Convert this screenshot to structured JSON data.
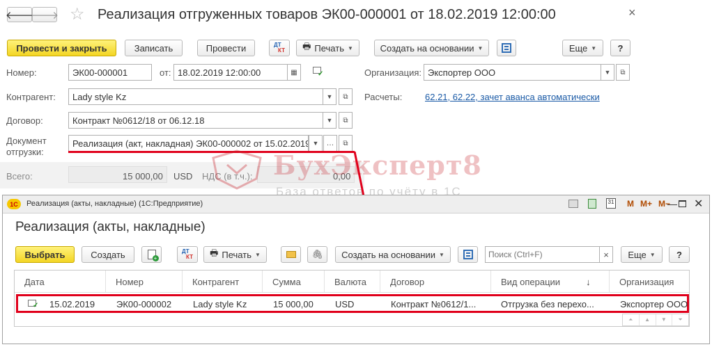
{
  "doc": {
    "title": "Реализация отгруженных товаров ЭК00-000001 от 18.02.2019 12:00:00",
    "toolbar": {
      "post_close": "Провести и закрыть",
      "save": "Записать",
      "post": "Провести",
      "dtkt_top": "ДТ",
      "dtkt_bottom": "КТ",
      "print": "Печать",
      "create_based": "Создать на основании",
      "more": "Еще",
      "help": "?"
    },
    "fields": {
      "number_label": "Номер:",
      "number_value": "ЭК00-000001",
      "date_label": "от:",
      "date_value": "18.02.2019 12:00:00",
      "org_label": "Организация:",
      "org_value": "Экспортер ООО",
      "counterparty_label": "Контрагент:",
      "counterparty_value": "Lady style Kz",
      "settlements_label": "Расчеты:",
      "settlements_link": "62.21, 62.22, зачет аванса автоматически",
      "contract_label": "Договор:",
      "contract_value": "Контракт №0612/18 от 06.12.18",
      "shipment_label_1": "Документ",
      "shipment_label_2": "отгрузки:",
      "shipment_value": "Реализация (акт, накладная) ЭК00-000002 от 15.02.2019",
      "total_label": "Всего:",
      "total_value": "15 000,00",
      "currency": "USD",
      "vat_label": "НДС (в т.ч.):",
      "vat_value": "0,00"
    }
  },
  "watermark": {
    "brand": "БухЭксперт8",
    "tagline": "База ответов по учёту в 1С"
  },
  "list": {
    "window_title": "Реализация (акты, накладные)  (1С:Предприятие)",
    "app_badge": "1С",
    "title_controls": {
      "m": "M",
      "mplus": "M+",
      "mminus": "M−"
    },
    "heading": "Реализация (акты, накладные)",
    "toolbar": {
      "select": "Выбрать",
      "create": "Создать",
      "dtkt_top": "ДТ",
      "dtkt_bottom": "КТ",
      "print": "Печать",
      "create_based": "Создать на основании",
      "search_placeholder": "Поиск (Ctrl+F)",
      "search_clear": "×",
      "more": "Еще",
      "help": "?"
    },
    "columns": [
      "Дата",
      "Номер",
      "Контрагент",
      "Сумма",
      "Валюта",
      "Договор",
      "Вид операции",
      "Организация"
    ],
    "sort_indicator": "↓",
    "rows": [
      {
        "date": "15.02.2019",
        "number": "ЭК00-000002",
        "counterparty": "Lady style Kz",
        "amount": "15 000,00",
        "currency": "USD",
        "contract": "Контракт №0612/1...",
        "operation": "Отгрузка без перехо...",
        "organization": "Экспортер ООО"
      }
    ]
  },
  "colors": {
    "accent_yellow": "#f3d524",
    "highlight_red": "#e0001b",
    "link_blue": "#1a5aa6",
    "watermark_red": "#c8232c"
  }
}
